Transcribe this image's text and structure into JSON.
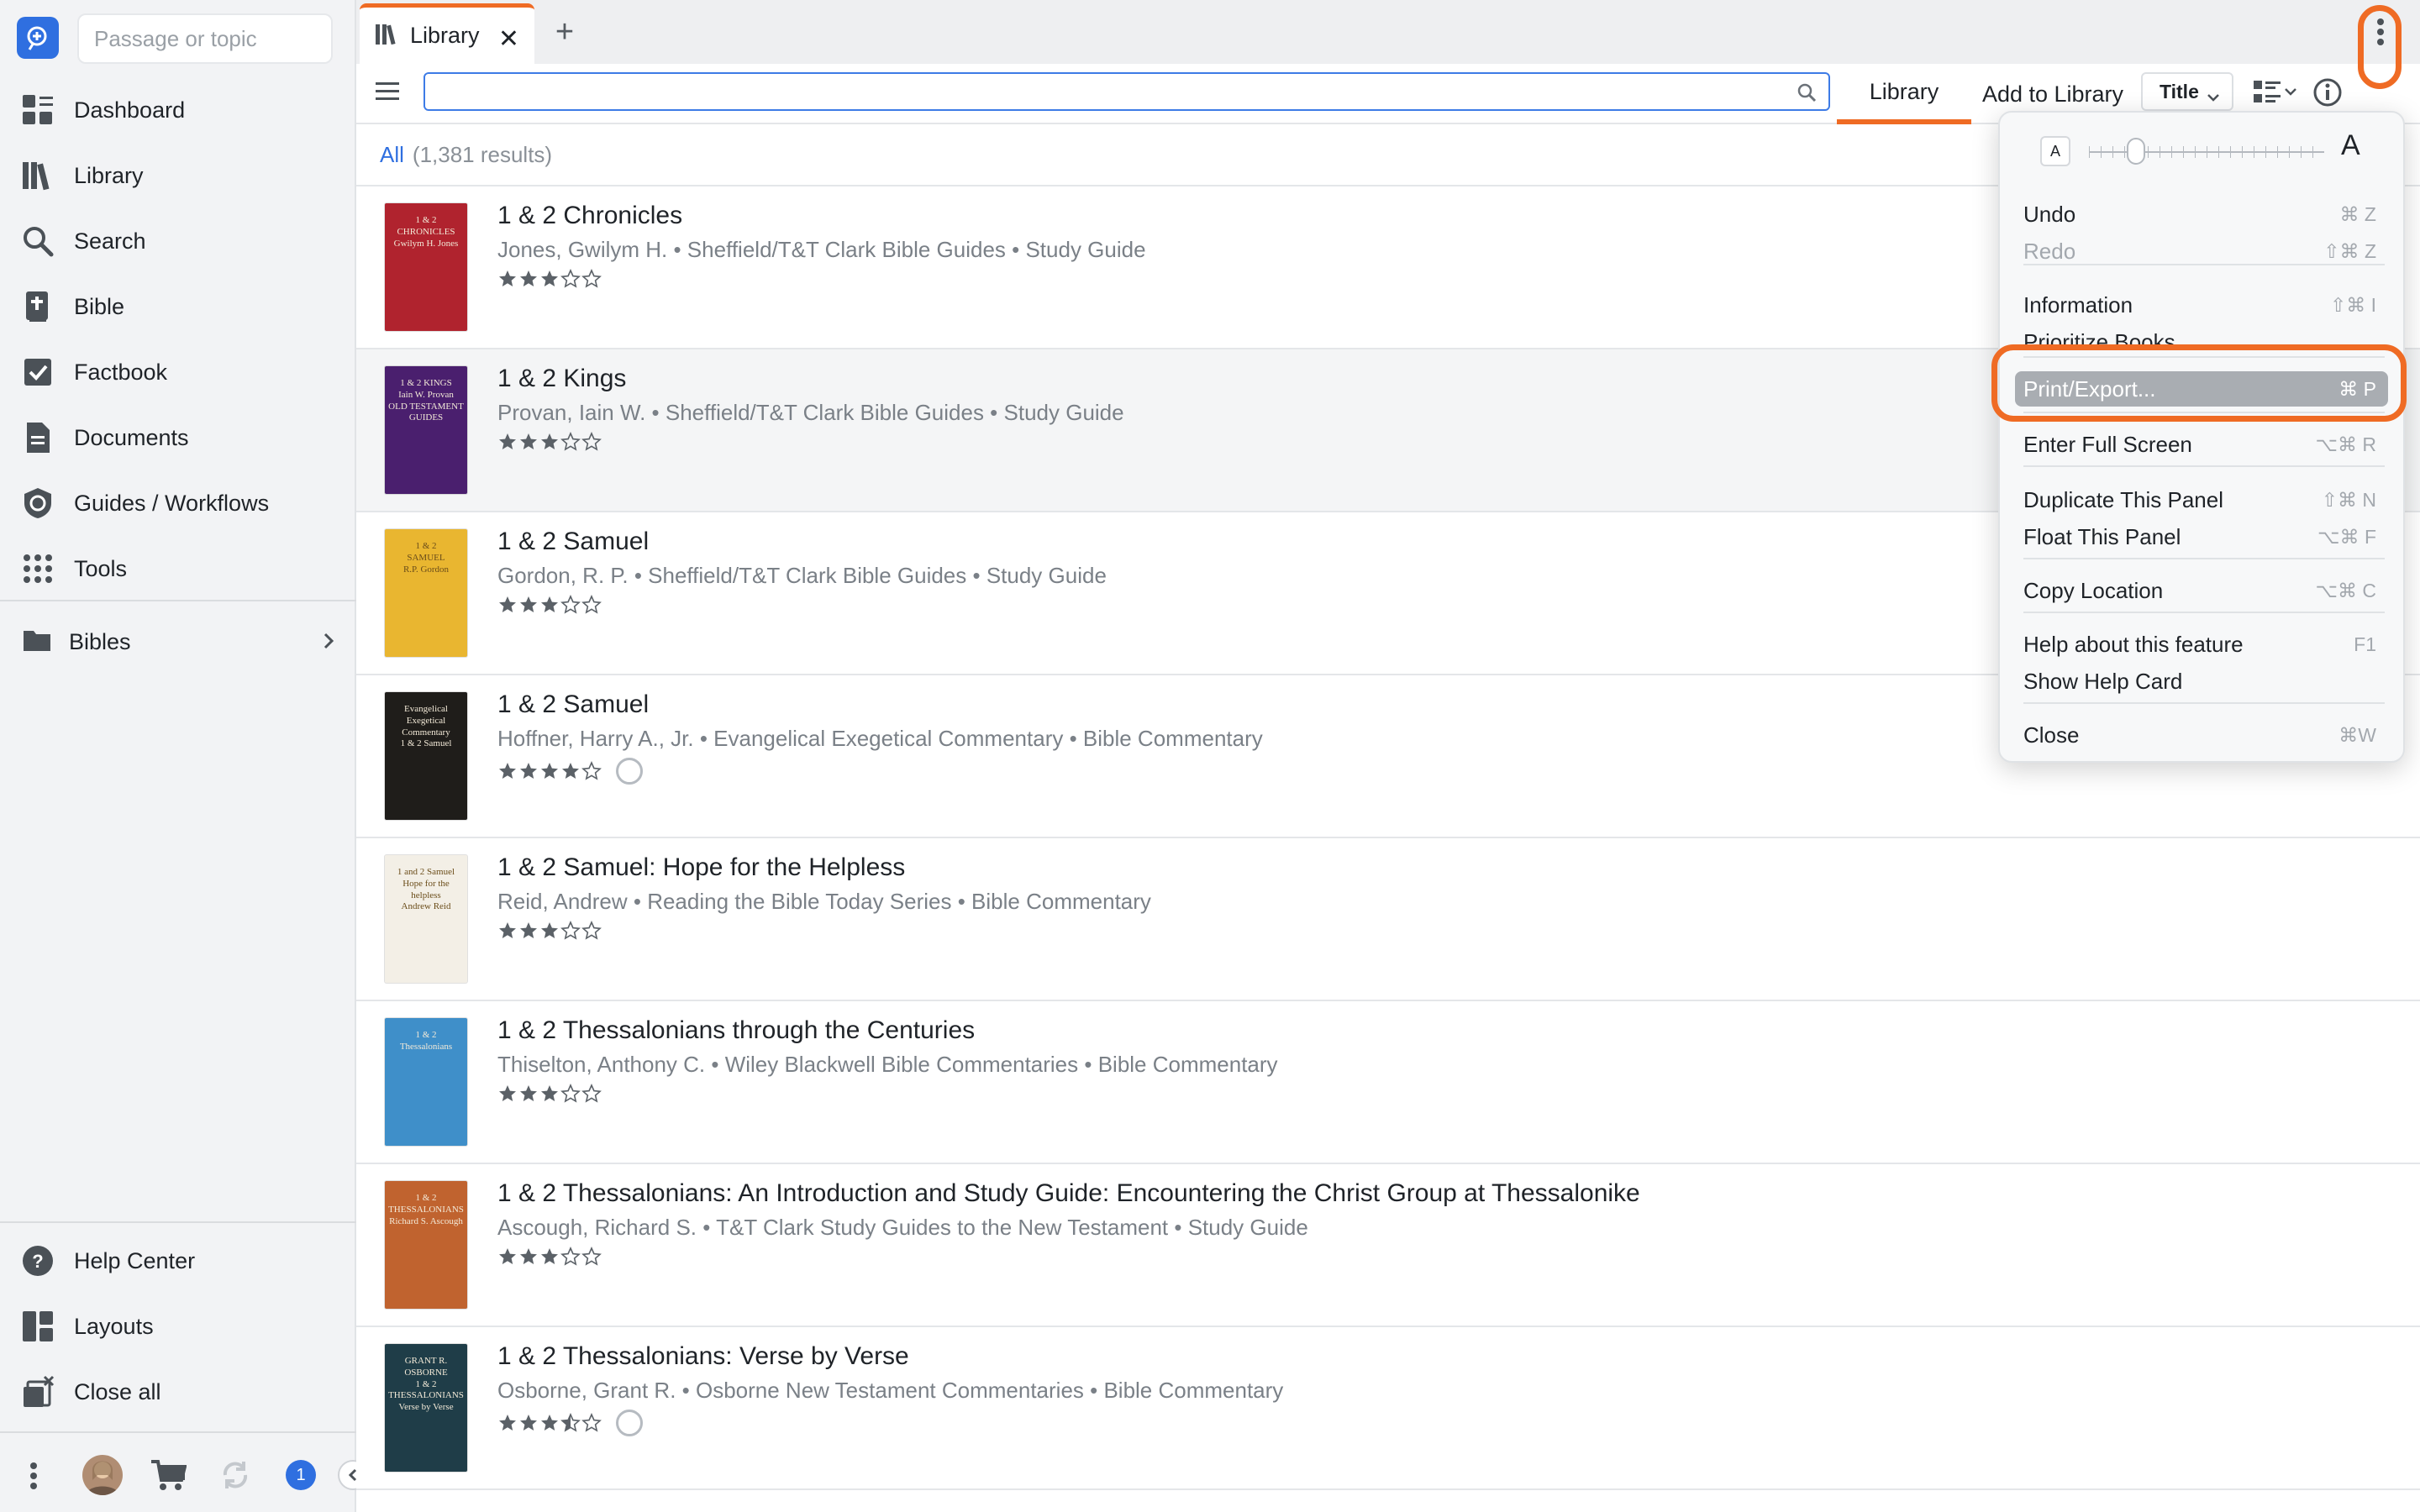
{
  "sidebar": {
    "passage_placeholder": "Passage or topic",
    "nav": [
      {
        "label": "Dashboard",
        "icon": "dashboard-icon"
      },
      {
        "label": "Library",
        "icon": "library-icon"
      },
      {
        "label": "Search",
        "icon": "search-icon"
      },
      {
        "label": "Bible",
        "icon": "bible-icon"
      },
      {
        "label": "Factbook",
        "icon": "factbook-icon"
      },
      {
        "label": "Documents",
        "icon": "documents-icon"
      },
      {
        "label": "Guides / Workflows",
        "icon": "guides-icon"
      },
      {
        "label": "Tools",
        "icon": "tools-icon"
      }
    ],
    "bibles_label": "Bibles",
    "bottom": [
      {
        "label": "Help Center",
        "icon": "help-icon"
      },
      {
        "label": "Layouts",
        "icon": "layouts-icon"
      },
      {
        "label": "Close all",
        "icon": "close-all-icon"
      }
    ],
    "notification_count": "1"
  },
  "tab": {
    "label": "Library",
    "close": "✕",
    "add": "+"
  },
  "toolbar": {
    "search_value": "",
    "tabs": [
      {
        "label": "Library"
      },
      {
        "label": "Add to Library"
      }
    ],
    "sort_label": "Title"
  },
  "results": {
    "all_label": "All",
    "count": "(1,381 results)"
  },
  "books": [
    {
      "title": "1 & 2 Chronicles",
      "meta": "Jones, Gwilym H. • Sheffield/T&T Clark Bible Guides • Study Guide",
      "rating": 3,
      "status": false,
      "cover_color": "#b0232e",
      "cover_text": "1 & 2\nCHRONICLES\nGwilym H. Jones"
    },
    {
      "title": "1 & 2 Kings",
      "meta": "Provan, Iain W. • Sheffield/T&T Clark Bible Guides • Study Guide",
      "rating": 3,
      "status": false,
      "cover_color": "#4a1f6e",
      "cover_text": "1 & 2 KINGS\nIain W. Provan\nOLD TESTAMENT GUIDES"
    },
    {
      "title": "1 & 2 Samuel",
      "meta": "Gordon, R. P. • Sheffield/T&T Clark Bible Guides • Study Guide",
      "rating": 3,
      "status": false,
      "cover_color": "#e9b630",
      "cover_text": "1 & 2\nSAMUEL\nR.P. Gordon"
    },
    {
      "title": "1 & 2 Samuel",
      "meta": "Hoffner, Harry A., Jr. • Evangelical Exegetical Commentary • Bible Commentary",
      "rating": 4,
      "status": true,
      "cover_color": "#1f1d1a",
      "cover_text": "Evangelical\nExegetical\nCommentary\n1 & 2 Samuel"
    },
    {
      "title": "1 & 2 Samuel: Hope for the Helpless",
      "meta": "Reid, Andrew • Reading the Bible Today Series • Bible Commentary",
      "rating": 3,
      "status": false,
      "cover_color": "#f3efe6",
      "cover_text": "1 and 2 Samuel\nHope for the helpless\nAndrew Reid"
    },
    {
      "title": "1 & 2 Thessalonians through the Centuries",
      "meta": "Thiselton, Anthony C. • Wiley Blackwell Bible Commentaries • Bible Commentary",
      "rating": 3,
      "status": false,
      "cover_color": "#3f8fc9",
      "cover_text": "1 & 2\nThessalonians"
    },
    {
      "title": "1 & 2 Thessalonians: An Introduction and Study Guide: Encountering the Christ Group at Thessalonike",
      "meta": "Ascough, Richard S. • T&T Clark Study Guides to the New Testament • Study Guide",
      "rating": 3,
      "status": false,
      "cover_color": "#c0632f",
      "cover_text": "1 & 2\nTHESSALONIANS\nRichard S. Ascough"
    },
    {
      "title": "1 & 2 Thessalonians: Verse by Verse",
      "meta": "Osborne, Grant R. • Osborne New Testament Commentaries • Bible Commentary",
      "rating": 3.5,
      "status": true,
      "cover_color": "#1f3d48",
      "cover_text": "GRANT R. OSBORNE\n1 & 2\nTHESSALONIANS\nVerse by Verse"
    }
  ],
  "menu": {
    "font_small": "A",
    "font_big": "A",
    "font_size_level": 0.2,
    "items": [
      {
        "label": "Undo",
        "shortcut": "⌘ Z",
        "disabled": false
      },
      {
        "label": "Redo",
        "shortcut": "⇧⌘ Z",
        "disabled": true
      },
      {
        "label": "Information",
        "shortcut": "⇧⌘ I",
        "disabled": false
      },
      {
        "label": "Prioritize Books",
        "shortcut": "",
        "disabled": false
      },
      {
        "label": "Print/Export...",
        "shortcut": "⌘ P",
        "disabled": false,
        "selected": true
      },
      {
        "label": "Enter Full Screen",
        "shortcut": "⌥⌘ R",
        "disabled": false
      },
      {
        "label": "Duplicate This Panel",
        "shortcut": "⇧⌘ N",
        "disabled": false
      },
      {
        "label": "Float This Panel",
        "shortcut": "⌥⌘ F",
        "disabled": false
      },
      {
        "label": "Copy Location",
        "shortcut": "⌥⌘ C",
        "disabled": false
      },
      {
        "label": "Help about this feature",
        "shortcut": "F1",
        "disabled": false
      },
      {
        "label": "Show Help Card",
        "shortcut": "",
        "disabled": false
      },
      {
        "label": "Close",
        "shortcut": "⌘W",
        "disabled": false
      }
    ]
  },
  "colors": {
    "accent": "#ef6b24",
    "brand": "#2f6fe0",
    "selected_item": "#a9adb2"
  }
}
